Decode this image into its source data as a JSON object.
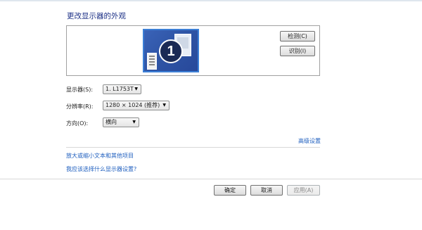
{
  "window": {
    "title": "更改显示器的外观"
  },
  "preview": {
    "monitor_number": "1",
    "detect_label": "检测(C)",
    "identify_label": "识别(I)"
  },
  "settings": {
    "display": {
      "label": "显示器(S):",
      "value": "1. L1753T"
    },
    "resolution": {
      "label": "分辨率(R):",
      "value": "1280 × 1024 (推荐)"
    },
    "orientation": {
      "label": "方向(O):",
      "value": "横向"
    }
  },
  "links": {
    "advanced": "高级设置",
    "enlarge": "放大或缩小文本和其他项目",
    "which": "我应该选择什么显示器设置?"
  },
  "footer": {
    "ok_label": "确定",
    "cancel_label": "取消",
    "apply_label": "应用(A)"
  },
  "icons": {
    "dropdown": "chevron-down-icon"
  }
}
